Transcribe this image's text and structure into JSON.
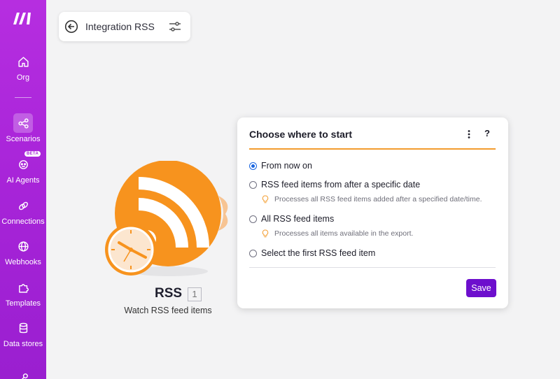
{
  "sidebar": {
    "items": [
      {
        "label": "Org",
        "icon": "home-icon"
      },
      {
        "label": "Scenarios",
        "icon": "share-icon",
        "active": true
      },
      {
        "label": "AI Agents",
        "icon": "ai-agent-icon",
        "badge": "BETA"
      },
      {
        "label": "Connections",
        "icon": "link-icon"
      },
      {
        "label": "Webhooks",
        "icon": "globe-icon"
      },
      {
        "label": "Templates",
        "icon": "puzzle-icon"
      },
      {
        "label": "Data stores",
        "icon": "database-icon"
      }
    ],
    "bg_color": "#a724d8"
  },
  "scenario": {
    "title": "Integration RSS"
  },
  "module": {
    "name": "RSS",
    "number": "1",
    "subtitle": "Watch RSS feed items",
    "color": "#f7931e"
  },
  "popup": {
    "title": "Choose where to start",
    "help_label": "?",
    "options": [
      {
        "label": "From now on",
        "checked": true
      },
      {
        "label": "RSS feed items from after a specific date",
        "hint": "Processes all RSS feed items added after a specified date/time."
      },
      {
        "label": "All RSS feed items",
        "hint": "Processes all items available in the export."
      },
      {
        "label": "Select the first RSS feed item"
      }
    ],
    "save_label": "Save",
    "accent_color": "#f39c2e",
    "save_color": "#6d0fcd"
  }
}
